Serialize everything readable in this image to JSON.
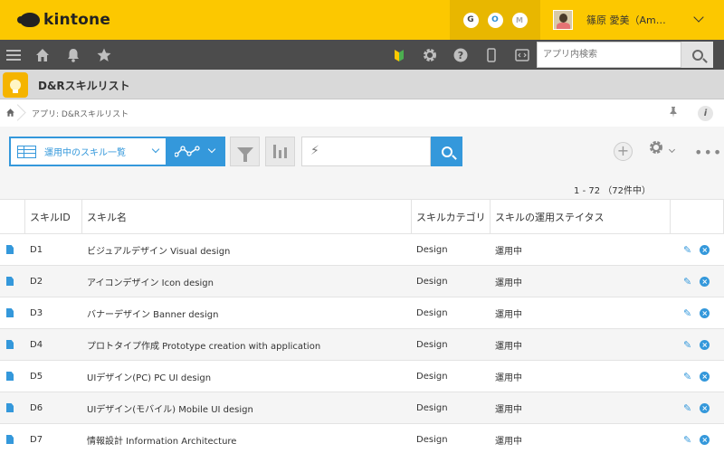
{
  "topbar": {
    "logo_text": "kintone",
    "apps": [
      "G",
      "O",
      "M"
    ],
    "user_name": "篠原 愛美（Am…"
  },
  "nav": {
    "search_placeholder": "アプリ内検索",
    "icons": [
      "menu-icon",
      "home-icon",
      "bell-icon",
      "star-icon",
      "beginner-icon",
      "gear-icon",
      "help-icon",
      "mobile-icon",
      "code-icon"
    ]
  },
  "app": {
    "title": "D&Rスキルリスト"
  },
  "breadcrumb": {
    "text": "アプリ: D&Rスキルリスト"
  },
  "toolbar": {
    "view_label": "運用中のスキル一覧",
    "keyword_icon": "⚡",
    "add": "+",
    "more": "•••"
  },
  "count": "1 - 72 （72件中）",
  "table": {
    "headers": [
      "スキルID",
      "スキル名",
      "スキルカテゴリ",
      "スキルの運用ステイタス"
    ],
    "rows": [
      {
        "id": "D1",
        "name": "ビジュアルデザイン Visual design",
        "category": "Design",
        "status": "運用中"
      },
      {
        "id": "D2",
        "name": "アイコンデザイン Icon design",
        "category": "Design",
        "status": "運用中"
      },
      {
        "id": "D3",
        "name": "バナーデザイン Banner design",
        "category": "Design",
        "status": "運用中"
      },
      {
        "id": "D4",
        "name": "プロトタイプ作成 Prototype creation with application",
        "category": "Design",
        "status": "運用中"
      },
      {
        "id": "D5",
        "name": "UIデザイン(PC) PC UI design",
        "category": "Design",
        "status": "運用中"
      },
      {
        "id": "D6",
        "name": "UIデザイン(モバイル) Mobile UI design",
        "category": "Design",
        "status": "運用中"
      },
      {
        "id": "D7",
        "name": "情報設計 Information Architecture",
        "category": "Design",
        "status": "運用中"
      }
    ]
  }
}
